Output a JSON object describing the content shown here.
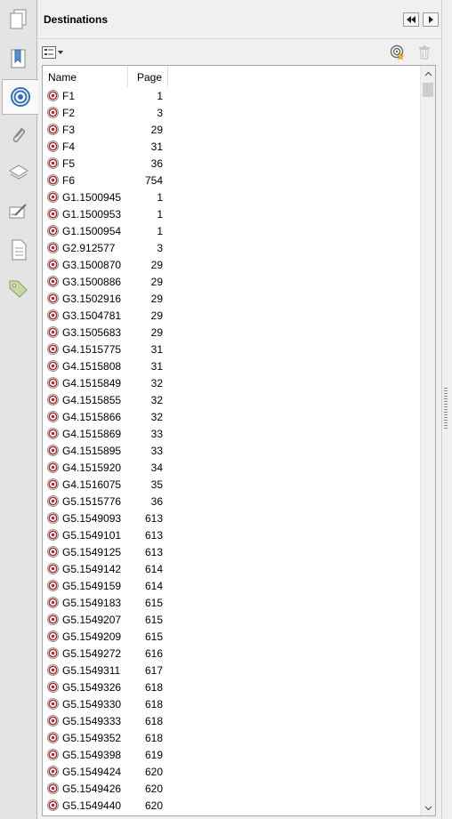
{
  "panel": {
    "title": "Destinations"
  },
  "columns": {
    "name": "Name",
    "page": "Page"
  },
  "icons": {
    "rail": [
      "pages-icon",
      "bookmarks-icon",
      "destinations-icon",
      "attachments-icon",
      "layers-icon",
      "signatures-icon",
      "content-icon",
      "tags-icon"
    ],
    "toolbar": [
      "options-menu-icon",
      "new-destination-icon",
      "delete-icon"
    ],
    "header": [
      "collapse-panel-icon",
      "expand-panel-icon"
    ],
    "row": "destination-target-icon"
  },
  "colors": {
    "target_red": "#b0262c",
    "accent_blue": "#2f6fbd"
  },
  "destinations": [
    {
      "name": "F1",
      "page": "1"
    },
    {
      "name": "F2",
      "page": "3"
    },
    {
      "name": "F3",
      "page": "29"
    },
    {
      "name": "F4",
      "page": "31"
    },
    {
      "name": "F5",
      "page": "36"
    },
    {
      "name": "F6",
      "page": "754"
    },
    {
      "name": "G1.1500945",
      "page": "1"
    },
    {
      "name": "G1.1500953",
      "page": "1"
    },
    {
      "name": "G1.1500954",
      "page": "1"
    },
    {
      "name": "G2.912577",
      "page": "3"
    },
    {
      "name": "G3.1500870",
      "page": "29"
    },
    {
      "name": "G3.1500886",
      "page": "29"
    },
    {
      "name": "G3.1502916",
      "page": "29"
    },
    {
      "name": "G3.1504781",
      "page": "29"
    },
    {
      "name": "G3.1505683",
      "page": "29"
    },
    {
      "name": "G4.1515775",
      "page": "31"
    },
    {
      "name": "G4.1515808",
      "page": "31"
    },
    {
      "name": "G4.1515849",
      "page": "32"
    },
    {
      "name": "G4.1515855",
      "page": "32"
    },
    {
      "name": "G4.1515866",
      "page": "32"
    },
    {
      "name": "G4.1515869",
      "page": "33"
    },
    {
      "name": "G4.1515895",
      "page": "33"
    },
    {
      "name": "G4.1515920",
      "page": "34"
    },
    {
      "name": "G4.1516075",
      "page": "35"
    },
    {
      "name": "G5.1515776",
      "page": "36"
    },
    {
      "name": "G5.1549093",
      "page": "613"
    },
    {
      "name": "G5.1549101",
      "page": "613"
    },
    {
      "name": "G5.1549125",
      "page": "613"
    },
    {
      "name": "G5.1549142",
      "page": "614"
    },
    {
      "name": "G5.1549159",
      "page": "614"
    },
    {
      "name": "G5.1549183",
      "page": "615"
    },
    {
      "name": "G5.1549207",
      "page": "615"
    },
    {
      "name": "G5.1549209",
      "page": "615"
    },
    {
      "name": "G5.1549272",
      "page": "616"
    },
    {
      "name": "G5.1549311",
      "page": "617"
    },
    {
      "name": "G5.1549326",
      "page": "618"
    },
    {
      "name": "G5.1549330",
      "page": "618"
    },
    {
      "name": "G5.1549333",
      "page": "618"
    },
    {
      "name": "G5.1549352",
      "page": "618"
    },
    {
      "name": "G5.1549398",
      "page": "619"
    },
    {
      "name": "G5.1549424",
      "page": "620"
    },
    {
      "name": "G5.1549426",
      "page": "620"
    },
    {
      "name": "G5.1549440",
      "page": "620"
    }
  ]
}
